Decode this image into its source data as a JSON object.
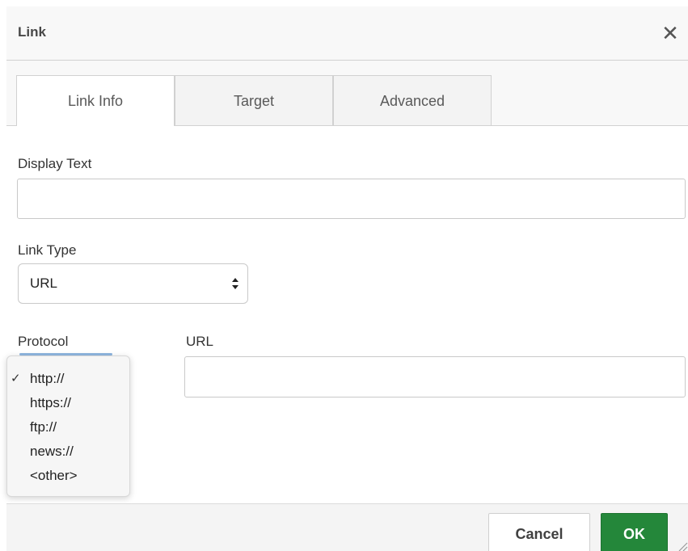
{
  "dialog": {
    "title": "Link",
    "close_icon": "close-icon"
  },
  "tabs": [
    {
      "label": "Link Info",
      "active": true
    },
    {
      "label": "Target",
      "active": false
    },
    {
      "label": "Advanced",
      "active": false
    }
  ],
  "form": {
    "display_text_label": "Display Text",
    "display_text_value": "",
    "link_type_label": "Link Type",
    "link_type_value": "URL",
    "protocol_label": "Protocol",
    "url_label": "URL",
    "url_value": ""
  },
  "protocol_dropdown": {
    "selected": "http://",
    "options": [
      "http://",
      "https://",
      "ftp://",
      "news://",
      "<other>"
    ],
    "check_icon": "checkmark-icon"
  },
  "footer": {
    "cancel_label": "Cancel",
    "ok_label": "OK"
  },
  "colors": {
    "ok_button": "#24873a",
    "focus_accent": "#8fb6e0"
  }
}
